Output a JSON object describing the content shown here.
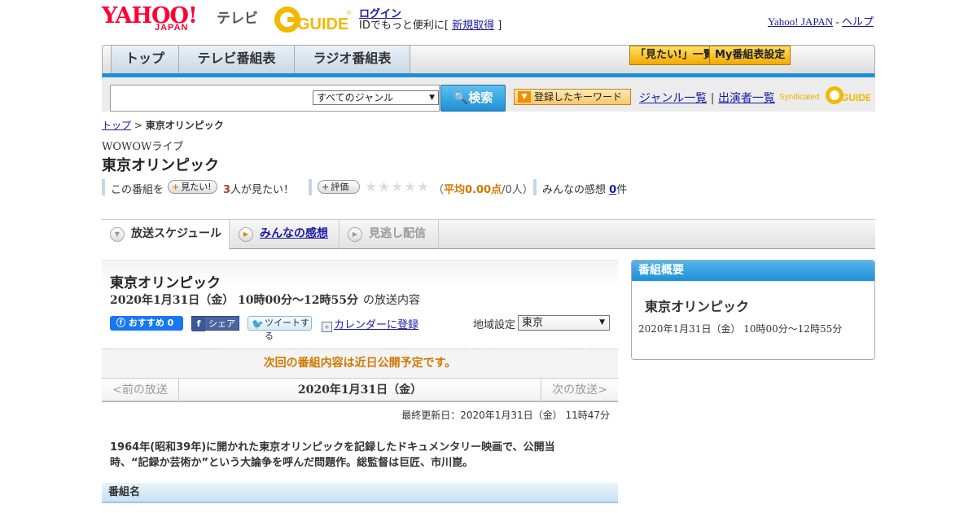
{
  "header": {
    "logo_yahoo": "YAHOO!",
    "logo_japan": "JAPAN",
    "logo_terebi": "テレビ",
    "logo_gguide": "G-GUIDE",
    "login": "ログイン",
    "id_msg_prefix": "IDでもっと便利に[ ",
    "signup": "新規取得",
    "id_msg_suffix": " ]",
    "yahoo_japan": "Yahoo! JAPAN",
    "sep": " - ",
    "help": "ヘルプ"
  },
  "nav": {
    "tabs": [
      "トップ",
      "テレビ番組表",
      "ラジオ番組表"
    ],
    "mitai_list": "「見たい!」一覧",
    "my_settings": "My番組表設定"
  },
  "search": {
    "genre_selected": "すべてのジャンル",
    "button": "検索",
    "registered_keyword": "登録したキーワード",
    "genre_list": "ジャンル一覧",
    "divider": " | ",
    "performer_list": "出演者一覧",
    "syndicated": "Syndicated"
  },
  "breadcrumb": {
    "home": "トップ",
    "sep": " > ",
    "current": "東京オリンピック"
  },
  "program": {
    "channel": "WOWOWライブ",
    "title": "東京オリンピック",
    "want_prefix": "この番組を",
    "want_button": "見たい!",
    "want_count": "3",
    "want_suffix": "人が見たい！",
    "rate_button": "評価",
    "rating_open": "（",
    "rating_avg": "平均0.00点",
    "rating_people": "/0人）",
    "impressions_label": "みんなの感想",
    "impressions_count": "0",
    "impressions_unit": "件"
  },
  "tabs": {
    "schedule": "放送スケジュール",
    "impressions": "みんなの感想",
    "vod": "見逃し配信"
  },
  "card": {
    "title": "東京オリンピック",
    "datetime": "2020年1月31日（金） 10時00分～12時55分",
    "datetime_suffix": "の放送内容",
    "fb_label": "おすすめ 0",
    "share_label": "シェア",
    "tweet_label": "ツイートする",
    "calendar_label": "カレンダーに登録",
    "region_label": "地域設定",
    "region_value": "東京"
  },
  "notice": "次回の番組内容は近日公開予定です。",
  "schedule_nav": {
    "prev": "<前の放送",
    "date": "2020年1月31日（金）",
    "next": "次の放送>"
  },
  "updated": "最終更新日：2020年1月31日（金） 11時47分",
  "description": "1964年(昭和39年)に開かれた東京オリンピックを記録したドキュメンタリー映画で、公開当時、“記録か芸術か”という大論争を呼んだ問題作。総監督は巨匠、市川崑。",
  "section_head": "番組名",
  "side": {
    "head": "番組概要",
    "title": "東京オリンピック",
    "date": "2020年1月31日（金） 10時00分～12時55分"
  },
  "colors": {
    "accent_blue": "#1e8fd6",
    "brand_red": "#ff0033",
    "notice_orange": "#d27800",
    "gold": "#f3a900"
  },
  "icons": [
    "search-icon",
    "dropdown-arrow-icon",
    "star-icon",
    "plus-icon",
    "facebook-icon",
    "twitter-bird-icon",
    "calendar-icon",
    "play-circle-icon"
  ]
}
